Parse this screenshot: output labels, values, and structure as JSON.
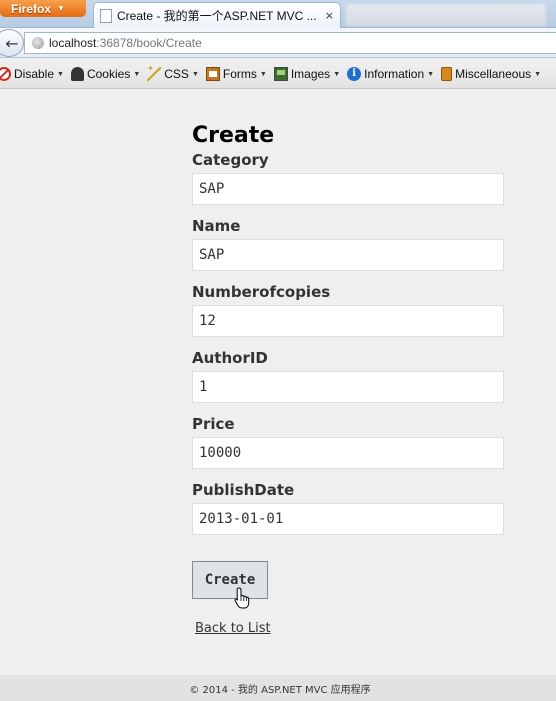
{
  "browser": {
    "app_button": "Firefox",
    "tab_title": "Create - 我的第一个ASP.NET MVC ...",
    "tab_close": "×",
    "url_host": "localhost",
    "url_rest": ":36878/book/Create"
  },
  "devbar": {
    "items": [
      {
        "label": "Disable",
        "icon": "disable-icon"
      },
      {
        "label": "Cookies",
        "icon": "cookies-icon"
      },
      {
        "label": "CSS",
        "icon": "css-icon"
      },
      {
        "label": "Forms",
        "icon": "forms-icon"
      },
      {
        "label": "Images",
        "icon": "images-icon"
      },
      {
        "label": "Information",
        "icon": "information-icon"
      },
      {
        "label": "Miscellaneous",
        "icon": "miscellaneous-icon"
      }
    ]
  },
  "page": {
    "heading": "Create",
    "fields": [
      {
        "label": "Category",
        "value": "SAP"
      },
      {
        "label": "Name",
        "value": "SAP"
      },
      {
        "label": "Numberofcopies",
        "value": "12"
      },
      {
        "label": "AuthorID",
        "value": "1"
      },
      {
        "label": "Price",
        "value": "10000"
      },
      {
        "label": "PublishDate",
        "value": "2013-01-01"
      }
    ],
    "submit_label": "Create",
    "back_link": "Back to List"
  },
  "footer": {
    "text": "© 2014 - 我的 ASP.NET MVC 应用程序"
  }
}
